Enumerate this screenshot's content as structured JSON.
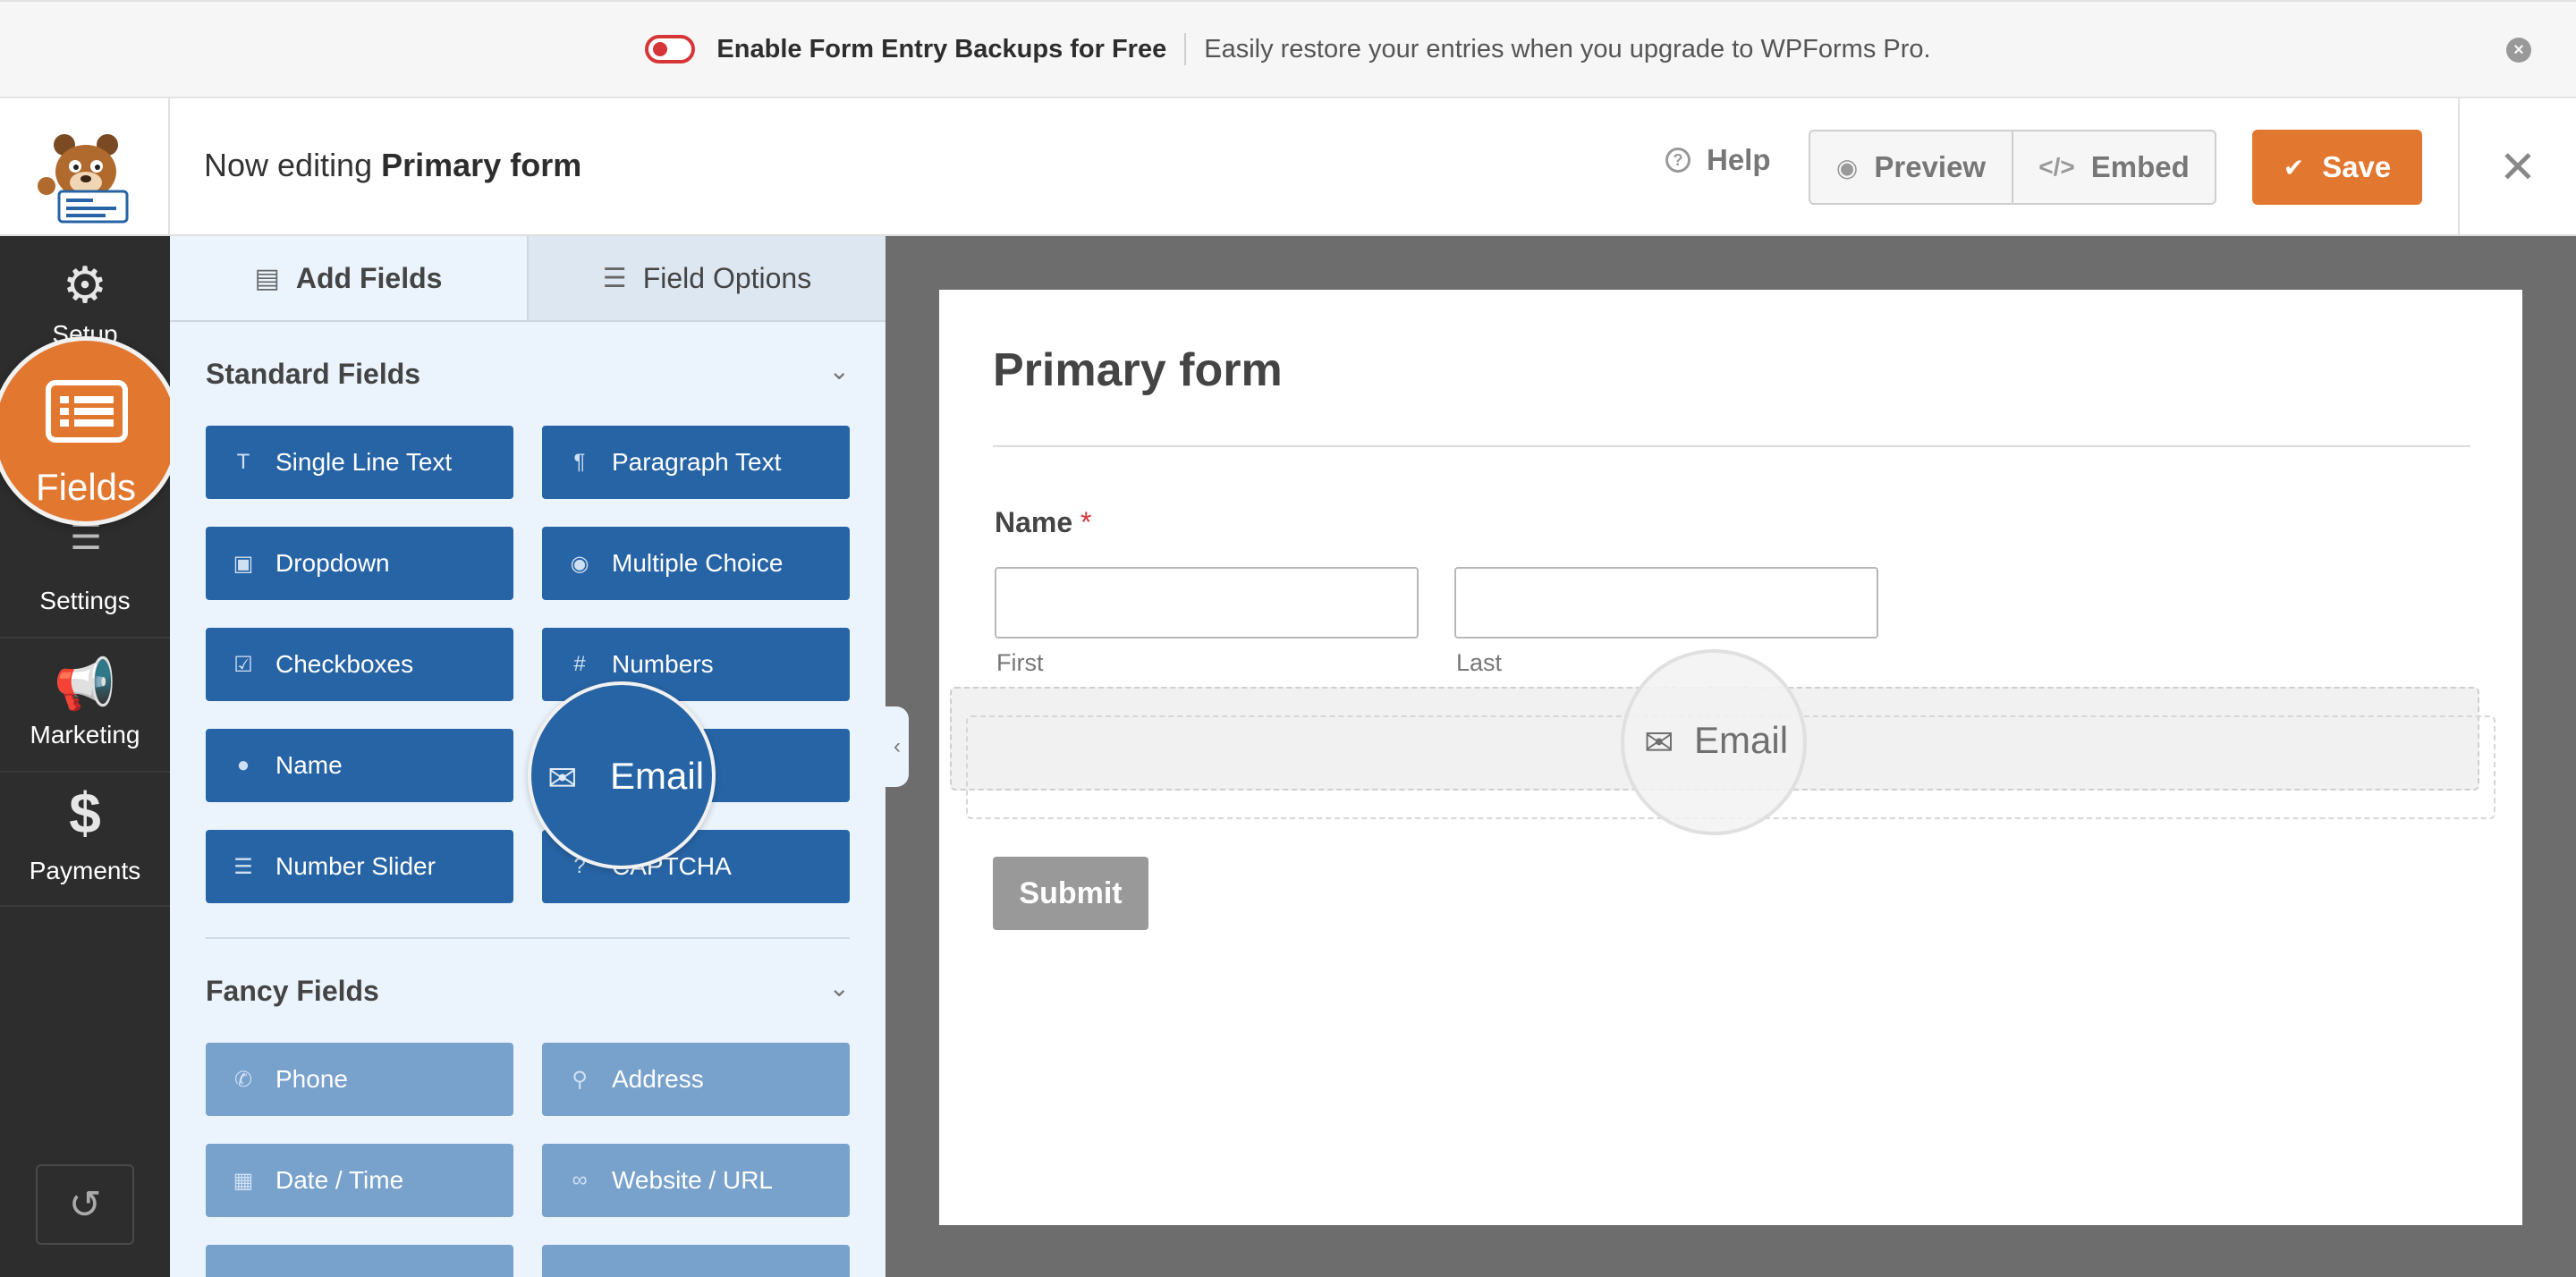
{
  "notice": {
    "toggle_state": "off",
    "strong": "Enable Form Entry Backups for Free",
    "text": "Easily restore your entries when you upgrade to WPForms Pro.",
    "close_symbol": "×"
  },
  "header": {
    "prefix": "Now editing",
    "form_name": "Primary form",
    "help_label": "Help",
    "preview_label": "Preview",
    "embed_label": "Embed",
    "save_label": "Save",
    "close_symbol": "✕"
  },
  "leftnav": {
    "items": [
      {
        "label": "Setup",
        "icon": "gear-icon"
      },
      {
        "label": "Fields",
        "icon": "list-icon",
        "active": true
      },
      {
        "label": "Settings",
        "icon": "sliders-icon"
      },
      {
        "label": "Marketing",
        "icon": "megaphone-icon"
      },
      {
        "label": "Payments",
        "icon": "dollar-icon"
      }
    ]
  },
  "panel": {
    "tabs": [
      {
        "label": "Add Fields",
        "icon": "list-icon",
        "active": true
      },
      {
        "label": "Field Options",
        "icon": "sliders-icon"
      }
    ],
    "standard": {
      "title": "Standard Fields",
      "buttons": [
        {
          "label": "Single Line Text",
          "icon": "text-icon"
        },
        {
          "label": "Paragraph Text",
          "icon": "paragraph-icon"
        },
        {
          "label": "Dropdown",
          "icon": "dropdown-icon"
        },
        {
          "label": "Multiple Choice",
          "icon": "radio-icon"
        },
        {
          "label": "Checkboxes",
          "icon": "checkbox-icon"
        },
        {
          "label": "Numbers",
          "icon": "hash-icon"
        },
        {
          "label": "Name",
          "icon": "user-icon"
        },
        {
          "label": "Email",
          "icon": "envelope-icon"
        },
        {
          "label": "Number Slider",
          "icon": "slider-icon"
        },
        {
          "label": "CAPTCHA",
          "icon": "question-icon"
        }
      ]
    },
    "fancy": {
      "title": "Fancy Fields",
      "buttons": [
        {
          "label": "Phone",
          "icon": "phone-icon"
        },
        {
          "label": "Address",
          "icon": "map-pin-icon"
        },
        {
          "label": "Date / Time",
          "icon": "calendar-icon"
        },
        {
          "label": "Website / URL",
          "icon": "link-icon"
        }
      ]
    }
  },
  "form": {
    "title": "Primary form",
    "name_label": "Name",
    "required_mark": "*",
    "first_label": "First",
    "last_label": "Last",
    "dragging_label": "Email",
    "submit_label": "Submit"
  },
  "colors": {
    "brand_orange": "#e27730",
    "field_blue": "#2764a5",
    "fancy_blue": "#78a1cc",
    "nav_dark": "#2d2d2d",
    "toggle_red": "#d63638"
  }
}
